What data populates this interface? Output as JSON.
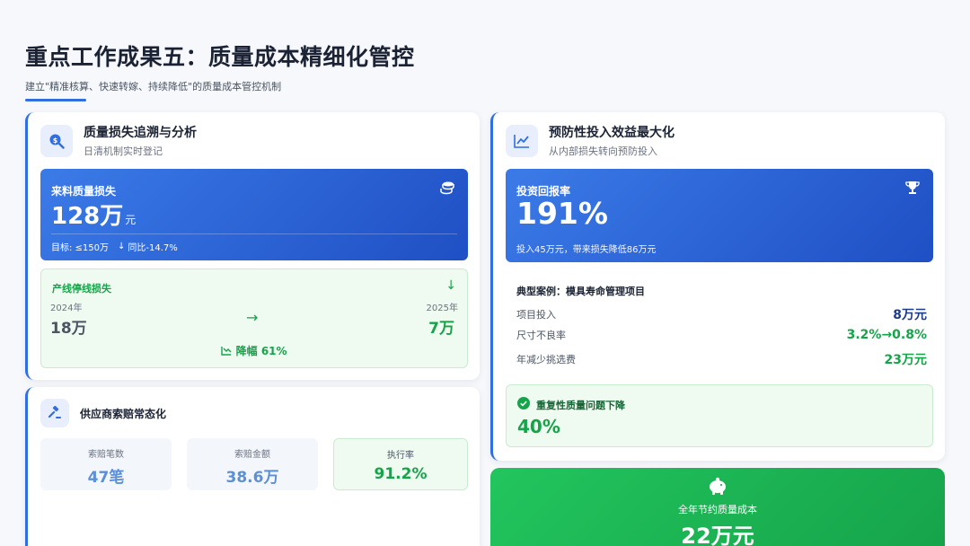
{
  "header": {
    "title": "重点工作成果五：质量成本精细化管控",
    "subtitle": "建立\"精准核算、快速转嫁、持续降低\"的质量成本管控机制"
  },
  "loss_card": {
    "title": "质量损失追溯与分析",
    "subtitle": "日清机制实时登记",
    "incoming": {
      "label": "来料质量损失",
      "value": "128万",
      "unit": "元",
      "target": "目标: ≤150万",
      "yoy": "同比-14.7%"
    },
    "line_stop": {
      "label": "产线停线损失",
      "from_year": "2024年",
      "from_value": "18万",
      "to_year": "2025年",
      "to_value": "7万",
      "drop": "降幅 61%"
    }
  },
  "claim_card": {
    "title": "供应商索赔常态化",
    "stats": [
      {
        "label": "索赔笔数",
        "value": "47笔"
      },
      {
        "label": "索赔金额",
        "value": "38.6万"
      },
      {
        "label": "执行率",
        "value": "91.2%"
      }
    ]
  },
  "invest_card": {
    "title": "预防性投入效益最大化",
    "subtitle": "从内部损失转向预防投入",
    "roi": {
      "label": "投资回报率",
      "value": "191%",
      "note": "投入45万元，带来损失降低86万元"
    },
    "case": {
      "title": "典型案例：模具寿命管理项目",
      "rows": [
        {
          "label": "项目投入",
          "value": "8万元"
        },
        {
          "label": "尺寸不良率",
          "value": "3.2%→0.8%"
        },
        {
          "label": "年减少挑选费",
          "value": "23万元"
        }
      ]
    },
    "repeat": {
      "label": "重复性质量问题下降",
      "value": "40%"
    }
  },
  "savings": {
    "label": "全年节约质量成本",
    "value": "22万元"
  },
  "colors": {
    "accent": "#2f6fe0",
    "green": "#16a34a",
    "navy": "#1e3a8a"
  }
}
